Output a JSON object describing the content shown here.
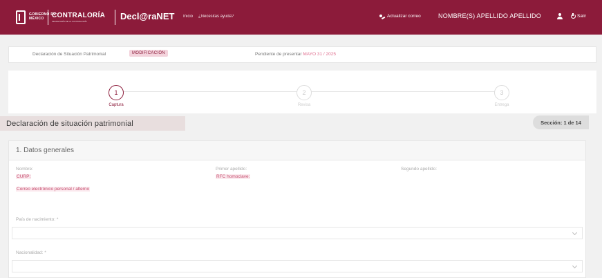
{
  "header": {
    "gob_line1": "GOBIERNO DE",
    "gob_line2": "MÉXICO",
    "org": "CONTRALORÍA",
    "org_sub": "SECRETARÍA DE LA CONTRALORÍA",
    "app": "Decl@raNET",
    "nav": [
      "Inicio",
      "¿Necesitas ayuda?"
    ],
    "update_email": "Actualizar correo",
    "user_name": "NOMBRE(S) APELLIDO APELLIDO",
    "logout": "Salir"
  },
  "infobar": {
    "declaration_label": "Declaración de Situación Patrimonial",
    "declaration_type": "MODIFICACIÓN",
    "pending_label": "Pendiente de presentar",
    "pending_date": "MAYO 31 / 2025"
  },
  "steps": [
    {
      "number": "1",
      "label": "Captura"
    },
    {
      "number": "2",
      "label": "Revisa"
    },
    {
      "number": "3",
      "label": "Entrega"
    }
  ],
  "section": {
    "title": "Declaración de situación patrimonial",
    "counter": "Sección: 1 de 14"
  },
  "card": {
    "title": "1. Datos generales",
    "nombre_label": "Nombre:",
    "primer_apellido_label": "Primer apellido:",
    "segundo_apellido_label": "Segundo apellido:",
    "curp_label": "CURP:",
    "rfc_label": "RFC homoclave:",
    "correo_label": "Correo electrónico personal / alterno",
    "pais_label": "País de nacimiento: *",
    "nacionalidad_label": "Nacionalidad: *"
  },
  "colors": {
    "brand": "#8c1b3a",
    "active_step": "#8c1b3a"
  }
}
